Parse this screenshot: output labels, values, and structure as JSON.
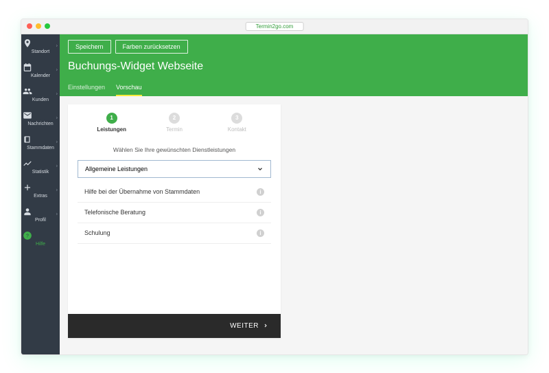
{
  "titlebar": {
    "url": "Termin2go.com"
  },
  "sidebar": {
    "items": [
      {
        "label": "Standort",
        "icon": "pin"
      },
      {
        "label": "Kalender",
        "icon": "calendar"
      },
      {
        "label": "Kunden",
        "icon": "people"
      },
      {
        "label": "Nachrichten",
        "icon": "mail"
      },
      {
        "label": "Stammdaten",
        "icon": "book"
      },
      {
        "label": "Statistik",
        "icon": "chart"
      },
      {
        "label": "Extras",
        "icon": "plus"
      },
      {
        "label": "Profil",
        "icon": "user"
      },
      {
        "label": "Hilfe",
        "icon": "help",
        "active": true
      }
    ]
  },
  "header": {
    "buttons": {
      "save": "Speichern",
      "reset": "Farben zurücksetzen"
    },
    "title": "Buchungs-Widget Webseite",
    "tabs": {
      "settings": "Einstellungen",
      "preview": "Vorschau"
    }
  },
  "widget": {
    "steps": [
      {
        "num": "1",
        "label": "Leistungen"
      },
      {
        "num": "2",
        "label": "Termin"
      },
      {
        "num": "3",
        "label": "Kontakt"
      }
    ],
    "instruction": "Wählen Sie Ihre gewünschten Dienstleistungen",
    "select_label": "Allgemeine Leistungen",
    "options": [
      "Hilfe bei der Übernahme von Stammdaten",
      "Telefonische Beratung",
      "Schulung"
    ],
    "next": "WEITER"
  }
}
